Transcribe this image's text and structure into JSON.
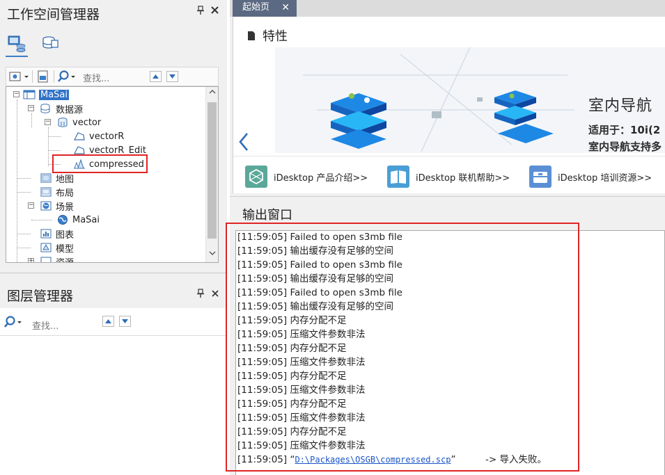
{
  "workspace": {
    "title": "工作空间管理器",
    "search_placeholder": "查找...",
    "tree": {
      "root": "MaSai",
      "datasources": "数据源",
      "vector": "vector",
      "vectorR": "vectorR",
      "vectorR_edit": "vectorR_Edit",
      "compressed": "compressed",
      "maps": "地图",
      "layouts": "布局",
      "scenes": "场景",
      "scene_masai": "MaSai",
      "charts": "图表",
      "models": "模型",
      "resources": "资源"
    }
  },
  "layer_manager": {
    "title": "图层管理器",
    "search_placeholder": "查找..."
  },
  "document_tab": {
    "label": "起始页",
    "close": "✕"
  },
  "start_page": {
    "section_title": "特性",
    "banner": {
      "title": "室内导航",
      "line1": "适用于：10i(2",
      "line2": "室内导航支持多"
    },
    "links": [
      {
        "label": "iDesktop 产品介绍>>"
      },
      {
        "label": "iDesktop 联机帮助>>"
      },
      {
        "label": "iDesktop 培训资源>>"
      }
    ]
  },
  "output": {
    "title": "输出窗口",
    "lines": [
      {
        "time": "[11:59:05]",
        "text": "Failed to open s3mb file"
      },
      {
        "time": "[11:59:05]",
        "text": "输出缓存没有足够的空间"
      },
      {
        "time": "[11:59:05]",
        "text": "Failed to open s3mb file"
      },
      {
        "time": "[11:59:05]",
        "text": "输出缓存没有足够的空间"
      },
      {
        "time": "[11:59:05]",
        "text": "Failed to open s3mb file"
      },
      {
        "time": "[11:59:05]",
        "text": "输出缓存没有足够的空间"
      },
      {
        "time": "[11:59:05]",
        "text": "内存分配不足"
      },
      {
        "time": "[11:59:05]",
        "text": "压缩文件参数非法"
      },
      {
        "time": "[11:59:05]",
        "text": "内存分配不足"
      },
      {
        "time": "[11:59:05]",
        "text": "压缩文件参数非法"
      },
      {
        "time": "[11:59:05]",
        "text": "内存分配不足"
      },
      {
        "time": "[11:59:05]",
        "text": "压缩文件参数非法"
      },
      {
        "time": "[11:59:05]",
        "text": "内存分配不足"
      },
      {
        "time": "[11:59:05]",
        "text": "压缩文件参数非法"
      },
      {
        "time": "[11:59:05]",
        "text": "内存分配不足"
      },
      {
        "time": "[11:59:05]",
        "text": "压缩文件参数非法"
      }
    ],
    "last_line": {
      "time": "[11:59:05]",
      "quote_open": "“",
      "path": "D:\\Packages\\OSGB\\compressed.scp",
      "quote_close": "”",
      "suffix": "-> 导入失败。"
    }
  },
  "colors": {
    "selection": "#2f72c7",
    "highlight_box": "#e02424",
    "tab_active": "#5b6a82",
    "link": "#1a54c7"
  }
}
